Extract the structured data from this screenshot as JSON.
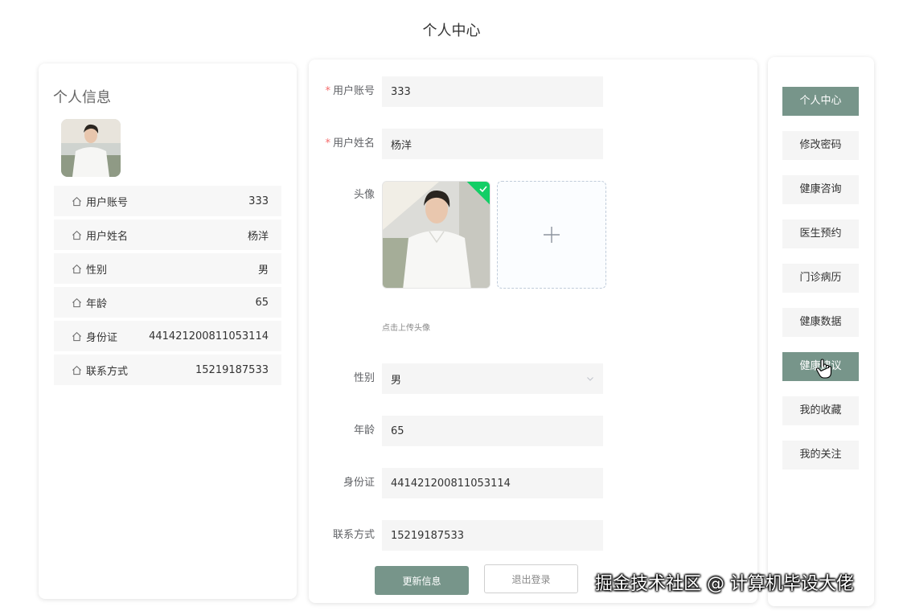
{
  "page_title": "个人中心",
  "left_panel": {
    "heading": "个人信息",
    "info": [
      {
        "label": "用户账号",
        "value": "333",
        "icon": "home-icon"
      },
      {
        "label": "用户姓名",
        "value": "杨洋",
        "icon": "home-icon"
      },
      {
        "label": "性别",
        "value": "男",
        "icon": "home-icon"
      },
      {
        "label": "年龄",
        "value": "65",
        "icon": "home-icon"
      },
      {
        "label": "身份证",
        "value": "441421200811053114",
        "icon": "home-icon"
      },
      {
        "label": "联系方式",
        "value": "15219187533",
        "icon": "home-icon"
      }
    ]
  },
  "form": {
    "account_label": "用户账号",
    "account_value": "333",
    "name_label": "用户姓名",
    "name_value": "杨洋",
    "required_mark": "*",
    "avatar_label": "头像",
    "upload_hint": "点击上传头像",
    "gender_label": "性别",
    "gender_value": "男",
    "age_label": "年龄",
    "age_value": "65",
    "idcard_label": "身份证",
    "idcard_value": "441421200811053114",
    "phone_label": "联系方式",
    "phone_value": "15219187533",
    "update_button": "更新信息",
    "logout_button": "退出登录"
  },
  "menu": [
    {
      "label": "个人中心",
      "active": true
    },
    {
      "label": "修改密码",
      "active": false
    },
    {
      "label": "健康咨询",
      "active": false
    },
    {
      "label": "医生预约",
      "active": false
    },
    {
      "label": "门诊病历",
      "active": false
    },
    {
      "label": "健康数据",
      "active": false
    },
    {
      "label": "健康建议",
      "active": true
    },
    {
      "label": "我的收藏",
      "active": false
    },
    {
      "label": "我的关注",
      "active": false
    }
  ],
  "watermark": "掘金技术社区 @ 计算机毕设大佬",
  "colors": {
    "accent": "#77958a",
    "success_badge": "#13ce66",
    "required": "#f56c6c"
  }
}
